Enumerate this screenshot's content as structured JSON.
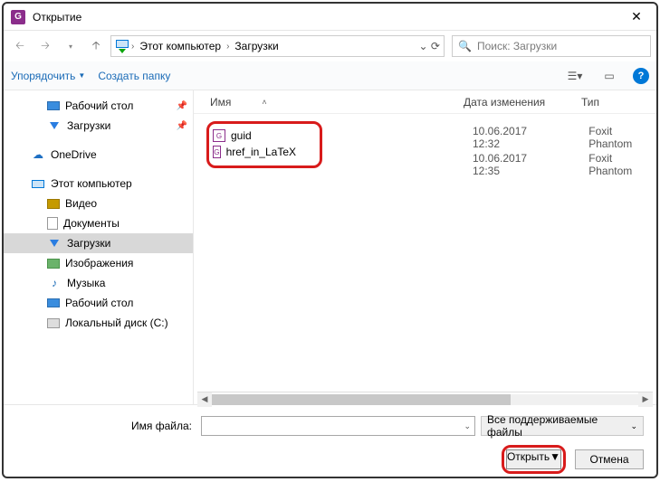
{
  "title": "Открытие",
  "nav": {
    "pc_label": "Этот компьютер",
    "current": "Загрузки",
    "search_placeholder": "Поиск: Загрузки"
  },
  "toolbar": {
    "organize": "Упорядочить",
    "new_folder": "Создать папку"
  },
  "sidebar": {
    "quick": {
      "desktop": "Рабочий стол",
      "downloads": "Загрузки"
    },
    "onedrive": "OneDrive",
    "this_pc": "Этот компьютер",
    "pc_children": {
      "video": "Видео",
      "documents": "Документы",
      "downloads": "Загрузки",
      "pictures": "Изображения",
      "music": "Музыка",
      "desktop": "Рабочий стол",
      "local_disk": "Локальный диск (C:)"
    }
  },
  "columns": {
    "name": "Имя",
    "date": "Дата изменения",
    "type": "Тип"
  },
  "files": [
    {
      "name": "guid",
      "date": "10.06.2017 12:32",
      "type": "Foxit Phantom"
    },
    {
      "name": "href_in_LaTeX",
      "date": "10.06.2017 12:35",
      "type": "Foxit Phantom"
    }
  ],
  "footer": {
    "filename_label": "Имя файла:",
    "filter": "Все поддерживаемые файлы",
    "open": "Открыть",
    "cancel": "Отмена"
  }
}
